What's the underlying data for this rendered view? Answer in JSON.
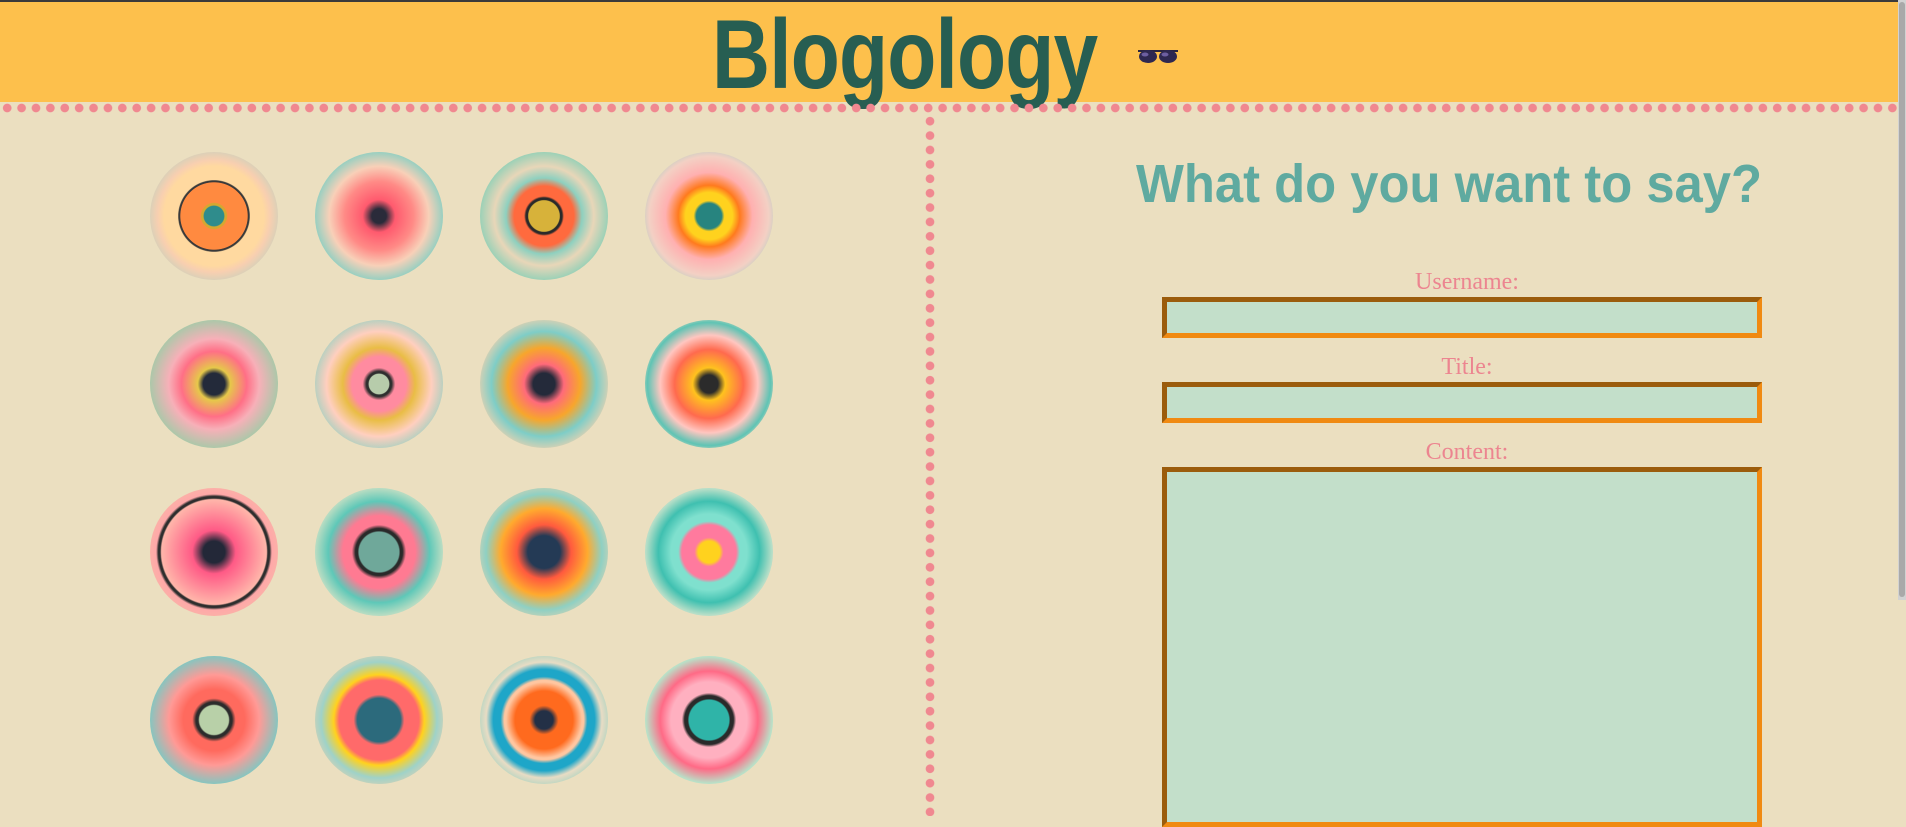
{
  "header": {
    "title": "Blogology",
    "icon": "sunglasses-icon",
    "background": "#fdc04c",
    "title_color": "#275e52"
  },
  "gallery": {
    "icon": "concentric-circle-art",
    "rows": 4,
    "columns": 4
  },
  "compose": {
    "heading": "What do you want to say?",
    "username_label": "Username:",
    "username_value": "",
    "title_label": "Title:",
    "title_value": "",
    "content_label": "Content:",
    "content_value": ""
  },
  "colors": {
    "page_background": "#ebdfc0",
    "accent_pink": "#ec8590",
    "heading_teal": "#5faaa0",
    "field_background": "#c3dfca",
    "field_border": "#f08a12"
  }
}
